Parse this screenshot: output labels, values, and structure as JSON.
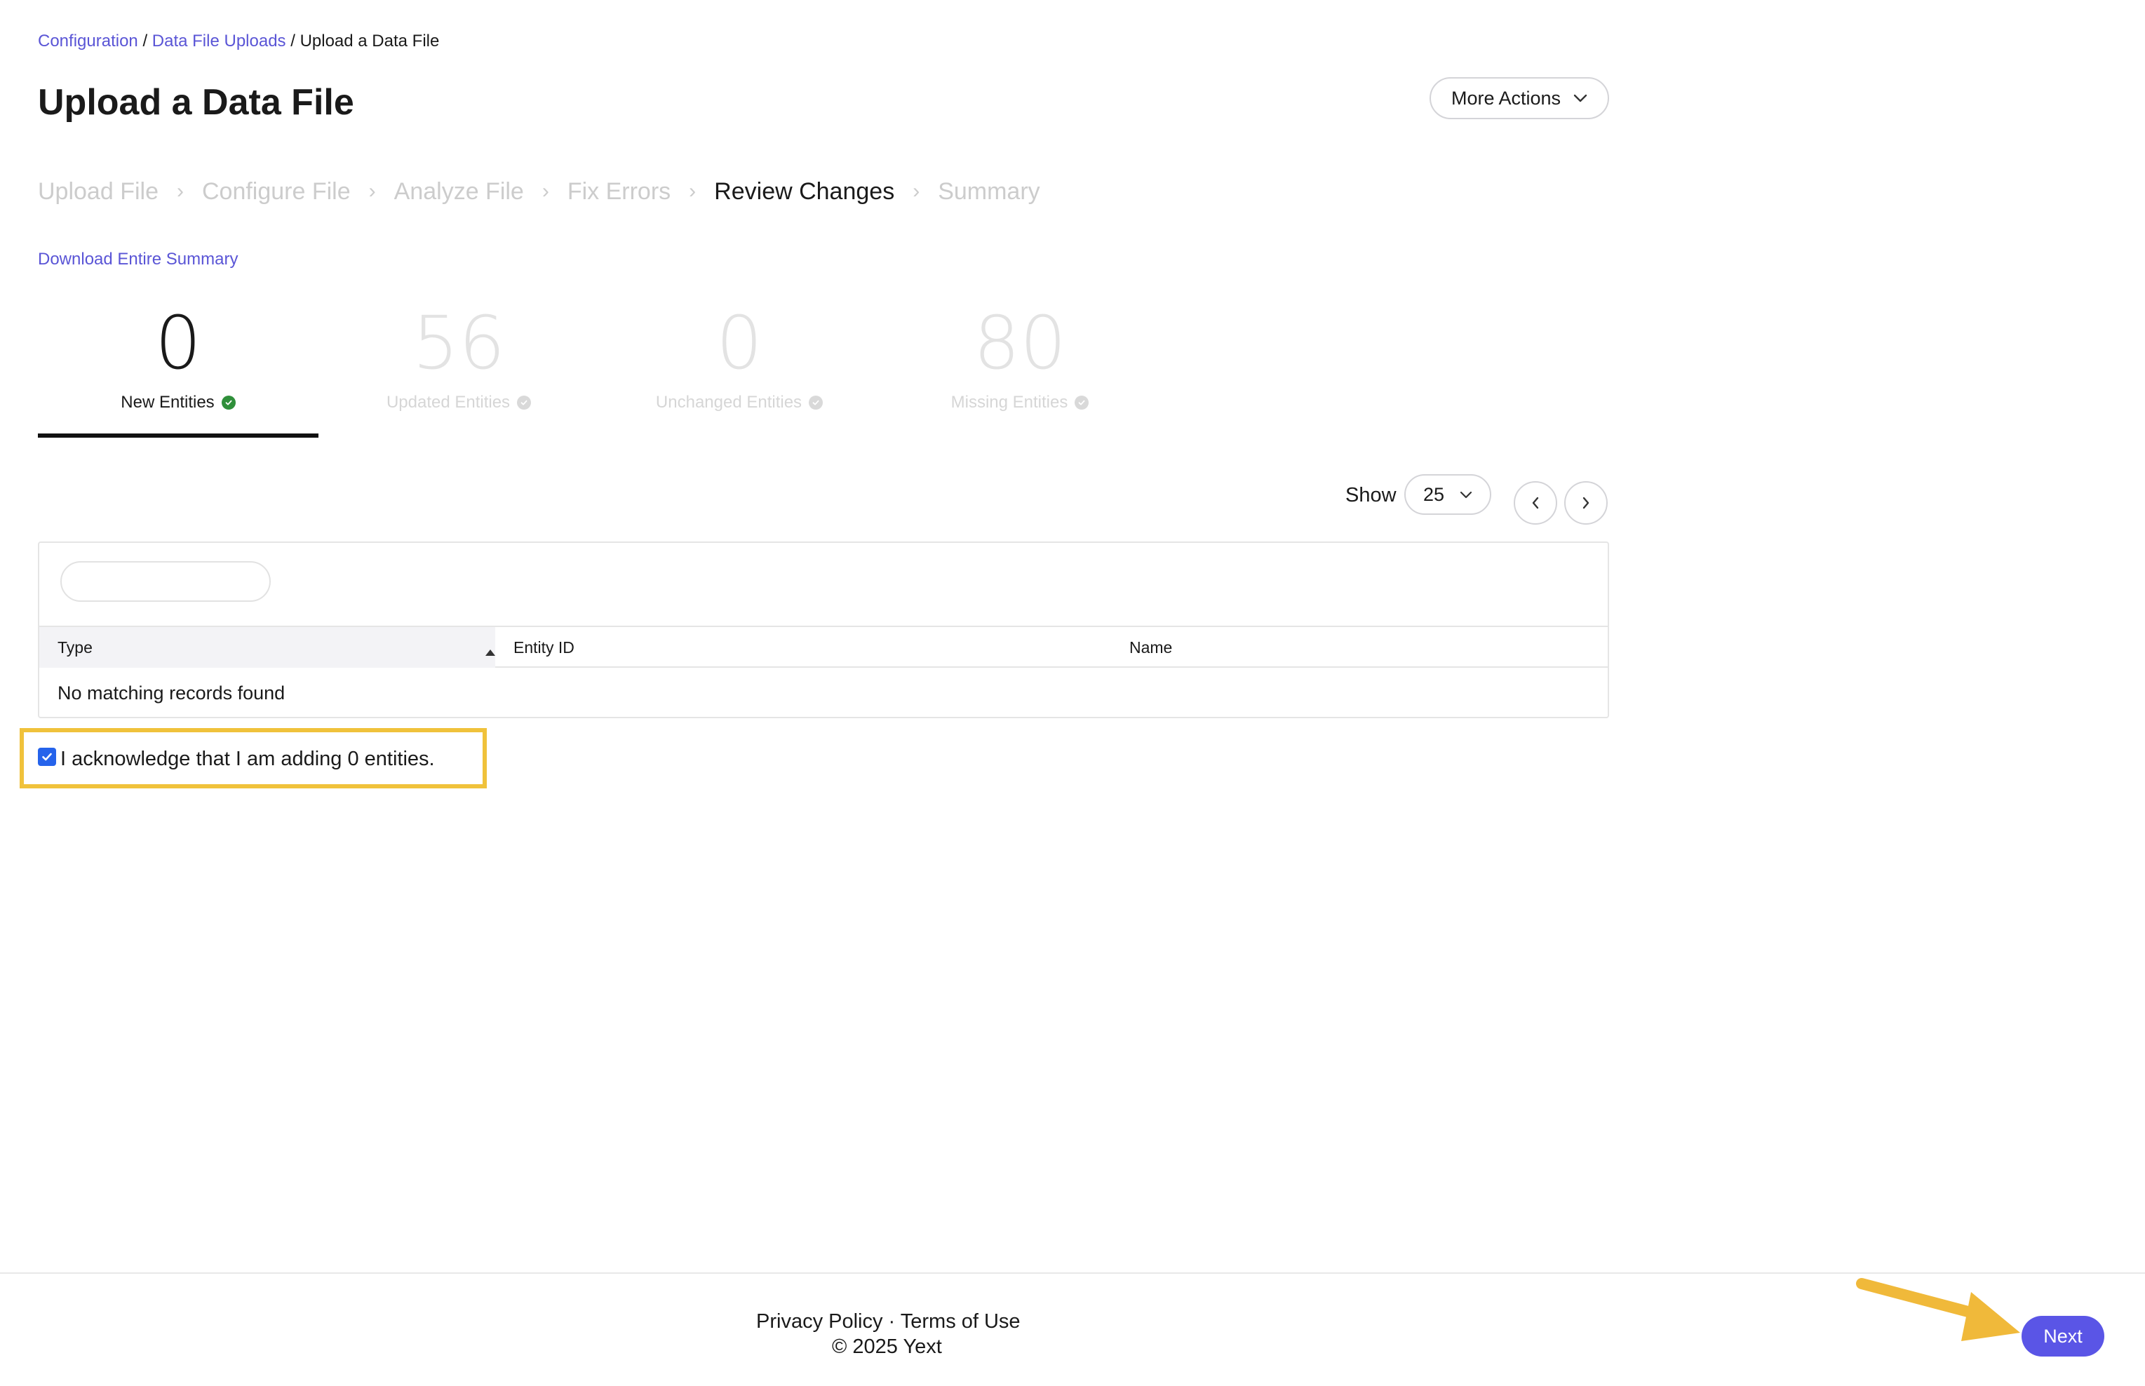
{
  "breadcrumb": {
    "items": [
      "Configuration",
      "Data File Uploads"
    ],
    "separator": "/",
    "current": "Upload a Data File"
  },
  "header": {
    "title": "Upload a Data File",
    "more_actions_label": "More Actions"
  },
  "steps": {
    "items": [
      "Upload File",
      "Configure File",
      "Analyze File",
      "Fix Errors",
      "Review Changes",
      "Summary"
    ],
    "active_index": 4,
    "separator": "›"
  },
  "download_summary_label": "Download Entire Summary",
  "stats": [
    {
      "value": "0",
      "label": "New Entities",
      "active": true
    },
    {
      "value": "56",
      "label": "Updated Entities",
      "active": false
    },
    {
      "value": "0",
      "label": "Unchanged Entities",
      "active": false
    },
    {
      "value": "80",
      "label": "Missing Entities",
      "active": false
    }
  ],
  "pagination": {
    "show_label": "Show",
    "page_size": "25"
  },
  "table": {
    "search_placeholder": "",
    "columns": [
      "Type",
      "Entity ID",
      "Name"
    ],
    "empty_message": "No matching records found"
  },
  "acknowledge": {
    "checked": true,
    "text": "I acknowledge that I am adding 0 entities."
  },
  "footer": {
    "privacy_label": "Privacy Policy",
    "dot": " · ",
    "terms_label": "Terms of Use",
    "copyright": "© 2025 Yext"
  },
  "next_label": "Next",
  "colors": {
    "accent": "#5a55e6",
    "link": "#5a55d6",
    "highlight": "#f0c23b",
    "success": "#2f8f3a"
  }
}
